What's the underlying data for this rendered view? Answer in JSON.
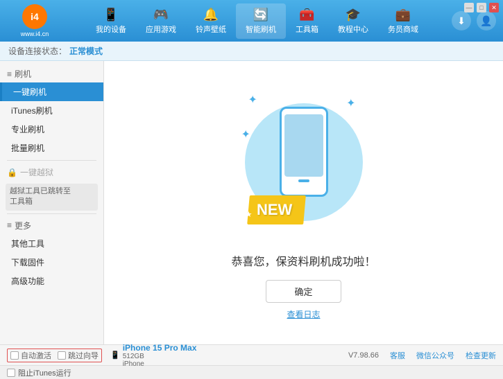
{
  "app": {
    "logo_char": "i4",
    "logo_url": "www.i4.cn"
  },
  "header": {
    "nav_tabs": [
      {
        "id": "my-device",
        "icon": "📱",
        "label": "我的设备"
      },
      {
        "id": "app-games",
        "icon": "👤",
        "label": "应用游戏"
      },
      {
        "id": "ringtone",
        "icon": "🔔",
        "label": "铃声壁纸"
      },
      {
        "id": "smart-flash",
        "icon": "🔄",
        "label": "智能刷机",
        "active": true
      },
      {
        "id": "toolbox",
        "icon": "🧰",
        "label": "工具箱"
      },
      {
        "id": "tutorials",
        "icon": "🎓",
        "label": "教程中心"
      },
      {
        "id": "service",
        "icon": "💼",
        "label": "务员商域"
      }
    ],
    "download_icon": "⬇",
    "user_icon": "👤"
  },
  "status_bar": {
    "label": "设备连接状态：",
    "value": "正常模式"
  },
  "sidebar": {
    "flash_title": "刷机",
    "items": [
      {
        "id": "one-click-flash",
        "label": "一键刷机",
        "active": true
      },
      {
        "id": "itunes-flash",
        "label": "iTunes刷机"
      },
      {
        "id": "pro-flash",
        "label": "专业刷机"
      },
      {
        "id": "batch-flash",
        "label": "批量刷机"
      }
    ],
    "jailbreak_label": "一键越狱",
    "jailbreak_note": "越狱工具已跳转至\n工具箱",
    "more_label": "更多",
    "more_items": [
      {
        "id": "other-tools",
        "label": "其他工具"
      },
      {
        "id": "download-firmware",
        "label": "下载固件"
      },
      {
        "id": "advanced",
        "label": "高级功能"
      }
    ]
  },
  "content": {
    "new_badge": "NEW",
    "success_message": "恭喜您，保资料刷机成功啦！",
    "confirm_button": "确定",
    "view_log_link": "查看日志"
  },
  "bottom_bar": {
    "auto_activate_label": "自动激活",
    "time_guide_label": "跳过向导",
    "device_icon": "📱",
    "device_name": "iPhone 15 Pro Max",
    "device_storage": "512GB",
    "device_type": "iPhone",
    "version": "V7.98.66",
    "client_label": "客服",
    "wechat_label": "微信公众号",
    "check_update_label": "检查更新",
    "itunes_label": "阻止iTunes运行"
  },
  "window_controls": {
    "minimize": "—",
    "maximize": "□",
    "close": "✕"
  }
}
